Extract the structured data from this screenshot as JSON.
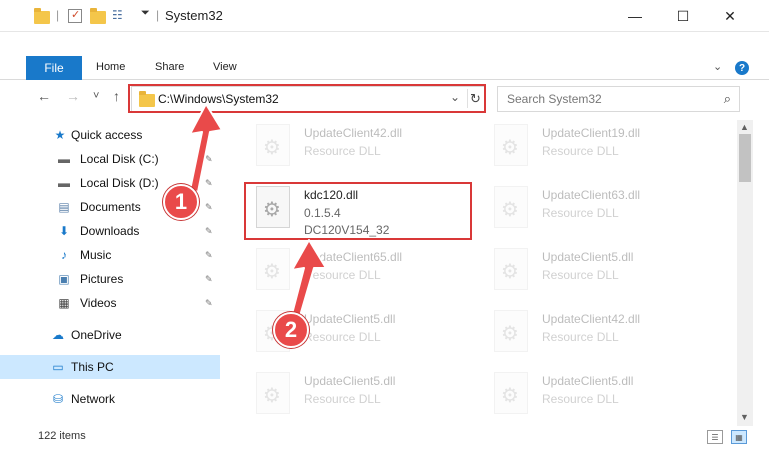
{
  "window": {
    "title": "System32",
    "minimize": "—",
    "maximize": "☐",
    "close": "✕"
  },
  "ribbon": {
    "tabs": [
      "File",
      "Home",
      "Share",
      "View"
    ],
    "collapse_chevron": "⌄",
    "help": "?"
  },
  "navigation": {
    "back": "←",
    "forward": "→",
    "recent": "˅",
    "up": "↑",
    "address": "C:\\Windows\\System32",
    "address_chevron": "⌄",
    "refresh": "↻",
    "search_placeholder": "Search System32"
  },
  "sidebar": {
    "items": [
      {
        "label": "Quick access",
        "icon": "star-icon",
        "glyph": "★",
        "color": "#1979ca",
        "pinned": false
      },
      {
        "label": "Local Disk (C:)",
        "icon": "drive-icon",
        "glyph": "▬",
        "color": "#666666",
        "pinned": true
      },
      {
        "label": "Local Disk (D:)",
        "icon": "drive-icon",
        "glyph": "▬",
        "color": "#666666",
        "pinned": true
      },
      {
        "label": "Documents",
        "icon": "documents-icon",
        "glyph": "▤",
        "color": "#5a7fa8",
        "pinned": true
      },
      {
        "label": "Downloads",
        "icon": "downloads-icon",
        "glyph": "⬇",
        "color": "#1979ca",
        "pinned": true
      },
      {
        "label": "Music",
        "icon": "music-icon",
        "glyph": "♪",
        "color": "#1979ca",
        "pinned": true
      },
      {
        "label": "Pictures",
        "icon": "pictures-icon",
        "glyph": "▣",
        "color": "#4a7fb0",
        "pinned": true
      },
      {
        "label": "Videos",
        "icon": "videos-icon",
        "glyph": "▦",
        "color": "#444444",
        "pinned": true
      },
      {
        "label": "OneDrive",
        "icon": "onedrive-icon",
        "glyph": "☁",
        "color": "#1979ca",
        "pinned": false
      },
      {
        "label": "This PC",
        "icon": "computer-icon",
        "glyph": "▭",
        "color": "#1979ca",
        "pinned": false
      },
      {
        "label": "Network",
        "icon": "network-icon",
        "glyph": "⛁",
        "color": "#1979ca",
        "pinned": false
      }
    ],
    "pin_glyph": "📌"
  },
  "files": [
    {
      "name": "UpdateClient42.dll",
      "desc": "Resource DLL"
    },
    {
      "name": "UpdateClient19.dll",
      "desc": "Resource DLL"
    },
    {
      "name": "kdc120.dll",
      "desc": "0.1.5.4",
      "desc2": "DC120V154_32"
    },
    {
      "name": "UpdateClient63.dll",
      "desc": "Resource DLL"
    },
    {
      "name": "UpdateClient65.dll",
      "desc": "Resource DLL"
    },
    {
      "name": "UpdateClient5.dll",
      "desc": "Resource DLL"
    },
    {
      "name": "UpdateClient5.dll",
      "desc": "Resource DLL"
    },
    {
      "name": "UpdateClient42.dll",
      "desc": "Resource DLL"
    },
    {
      "name": "UpdateClient5.dll",
      "desc": "Resource DLL"
    },
    {
      "name": "UpdateClient5.dll",
      "desc": "Resource DLL"
    }
  ],
  "annotations": {
    "step1": "1",
    "step2": "2"
  },
  "status": {
    "item_count": "122 items"
  }
}
